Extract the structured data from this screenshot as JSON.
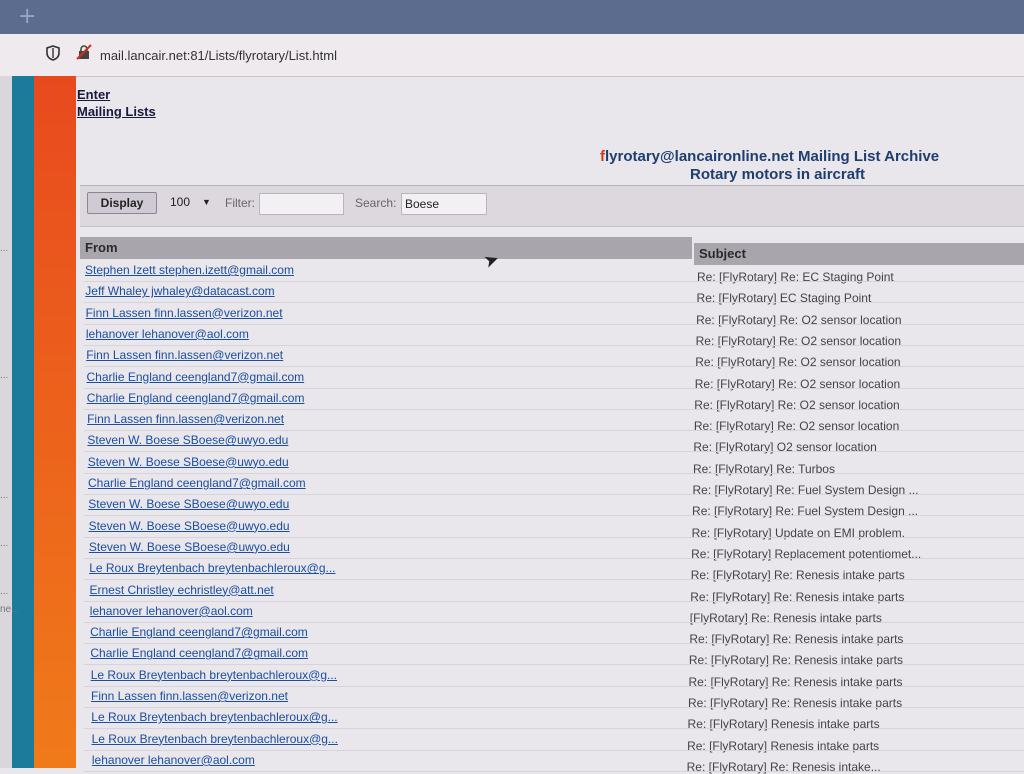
{
  "browser": {
    "new_tab_glyph": "+",
    "url": "mail.lancair.net:81/Lists/flyrotary/List.html",
    "icons": [
      "shield-icon",
      "insecure-lock-icon"
    ]
  },
  "left_edge_fragments": [
    "...",
    "...",
    "...",
    "...",
    "...",
    "ne..."
  ],
  "nav": {
    "enter": "Enter",
    "mailing_lists": "Mailing Lists"
  },
  "header": {
    "title_first_letter": "f",
    "title_rest": "lyrotary@lancaironline.net Mailing List Archive",
    "subtitle": "Rotary motors in aircraft"
  },
  "toolbar": {
    "display_label": "Display",
    "page_size": "100",
    "filter_label": "Filter:",
    "filter_value": "",
    "search_label": "Search:",
    "search_value": "Boese"
  },
  "table": {
    "columns": {
      "from": "From",
      "subject": "Subject"
    },
    "rows": [
      {
        "from": "Stephen Izett stephen.izett@gmail.com",
        "subject": "Re: [FlyRotary] Re: EC Staging Point"
      },
      {
        "from": "Jeff Whaley jwhaley@datacast.com",
        "subject": "Re: [FlyRotary] EC Staging Point"
      },
      {
        "from": "Finn Lassen finn.lassen@verizon.net",
        "subject": "Re: [FlyRotary] Re: O2 sensor location"
      },
      {
        "from": "lehanover lehanover@aol.com",
        "subject": "Re: [FlyRotary] Re: O2 sensor location"
      },
      {
        "from": "Finn Lassen finn.lassen@verizon.net",
        "subject": "Re: [FlyRotary] Re: O2 sensor location"
      },
      {
        "from": "Charlie England ceengland7@gmail.com",
        "subject": "Re: [FlyRotary] Re: O2 sensor location"
      },
      {
        "from": "Charlie England ceengland7@gmail.com",
        "subject": "Re: [FlyRotary] Re: O2 sensor location"
      },
      {
        "from": "Finn Lassen finn.lassen@verizon.net",
        "subject": "Re: [FlyRotary] Re: O2 sensor location"
      },
      {
        "from": "Steven W. Boese SBoese@uwyo.edu",
        "subject": "Re: [FlyRotary] O2 sensor location"
      },
      {
        "from": "Steven W. Boese SBoese@uwyo.edu",
        "subject": "Re: [FlyRotary] Re: Turbos"
      },
      {
        "from": "Charlie England ceengland7@gmail.com",
        "subject": "Re: [FlyRotary] Re: Fuel System Design ..."
      },
      {
        "from": "Steven W. Boese SBoese@uwyo.edu",
        "subject": "Re: [FlyRotary] Re: Fuel System Design ..."
      },
      {
        "from": "Steven W. Boese SBoese@uwyo.edu",
        "subject": "Re: [FlyRotary] Update on EMI problem."
      },
      {
        "from": "Steven W. Boese SBoese@uwyo.edu",
        "subject": "Re: [FlyRotary] Replacement potentiomet..."
      },
      {
        "from": "Le Roux Breytenbach breytenbachleroux@g...",
        "subject": "Re: [FlyRotary] Re: Renesis intake parts"
      },
      {
        "from": "Ernest Christley echristley@att.net",
        "subject": "Re: [FlyRotary] Re: Renesis intake parts"
      },
      {
        "from": "lehanover lehanover@aol.com",
        "subject": "[FlyRotary] Re: Renesis intake parts"
      },
      {
        "from": "Charlie England ceengland7@gmail.com",
        "subject": "Re: [FlyRotary] Re: Renesis intake parts"
      },
      {
        "from": "Charlie England ceengland7@gmail.com",
        "subject": "Re: [FlyRotary] Re: Renesis intake parts"
      },
      {
        "from": "Le Roux Breytenbach breytenbachleroux@g...",
        "subject": "Re: [FlyRotary] Re: Renesis intake parts"
      },
      {
        "from": "Finn Lassen finn.lassen@verizon.net",
        "subject": "Re: [FlyRotary] Re: Renesis intake parts"
      },
      {
        "from": "Le Roux Breytenbach breytenbachleroux@g...",
        "subject": "Re: [FlyRotary] Renesis intake parts"
      },
      {
        "from": "Le Roux Breytenbach breytenbachleroux@g...",
        "subject": "Re: [FlyRotary] Renesis intake parts"
      },
      {
        "from": "lehanover lehanover@aol.com",
        "subject": "Re: [FlyRotary] Re: Renesis intake..."
      }
    ]
  }
}
